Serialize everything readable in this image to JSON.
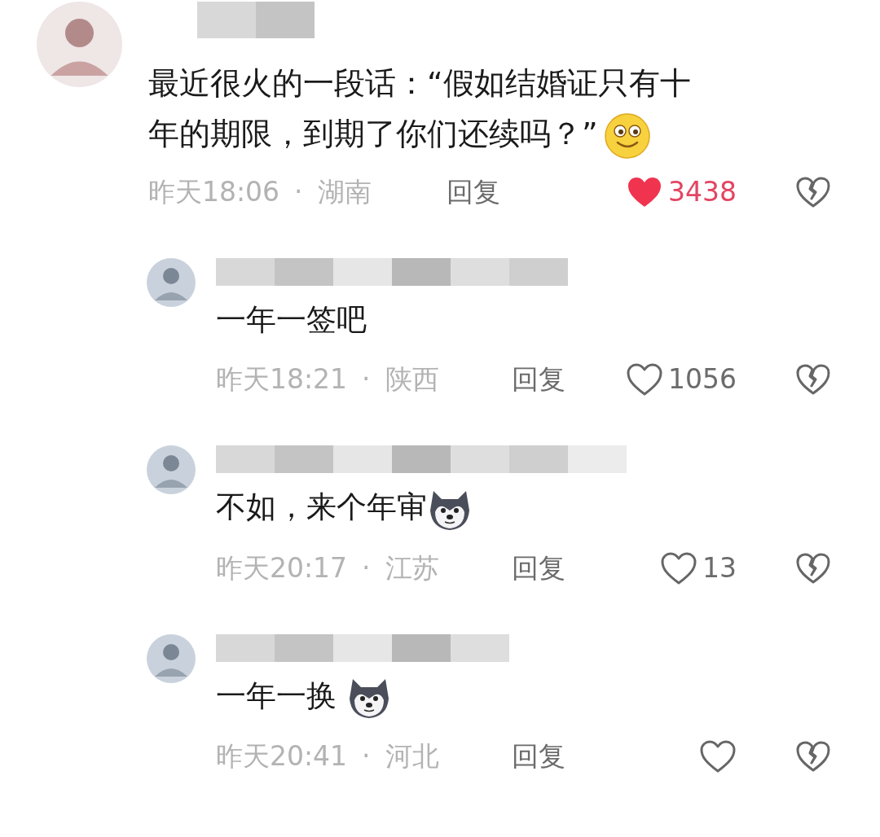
{
  "comments": [
    {
      "kind": "top",
      "text": "最近很火的一段话：“假如结婚证只有十年的期限，到期了你们还续吗？”",
      "emoji": {
        "kind": "smile"
      },
      "time": "昨天18:06",
      "separator": "·",
      "location": "湖南",
      "reply": "回复",
      "likes": "3438",
      "liked": true
    },
    {
      "kind": "reply",
      "text": "一年一签吧",
      "time": "昨天18:21",
      "separator": "·",
      "location": "陕西",
      "reply": "回复",
      "likes": "1056",
      "liked": false
    },
    {
      "kind": "reply",
      "text": "不如，来个年审",
      "emoji": {
        "kind": "husky"
      },
      "time": "昨天20:17",
      "separator": "·",
      "location": "江苏",
      "reply": "回复",
      "likes": "13",
      "liked": false
    },
    {
      "kind": "reply",
      "text": "一年一换",
      "emoji": {
        "kind": "husky"
      },
      "time": "昨天20:41",
      "separator": "·",
      "location": "河北",
      "reply": "回复",
      "liked": false
    }
  ]
}
